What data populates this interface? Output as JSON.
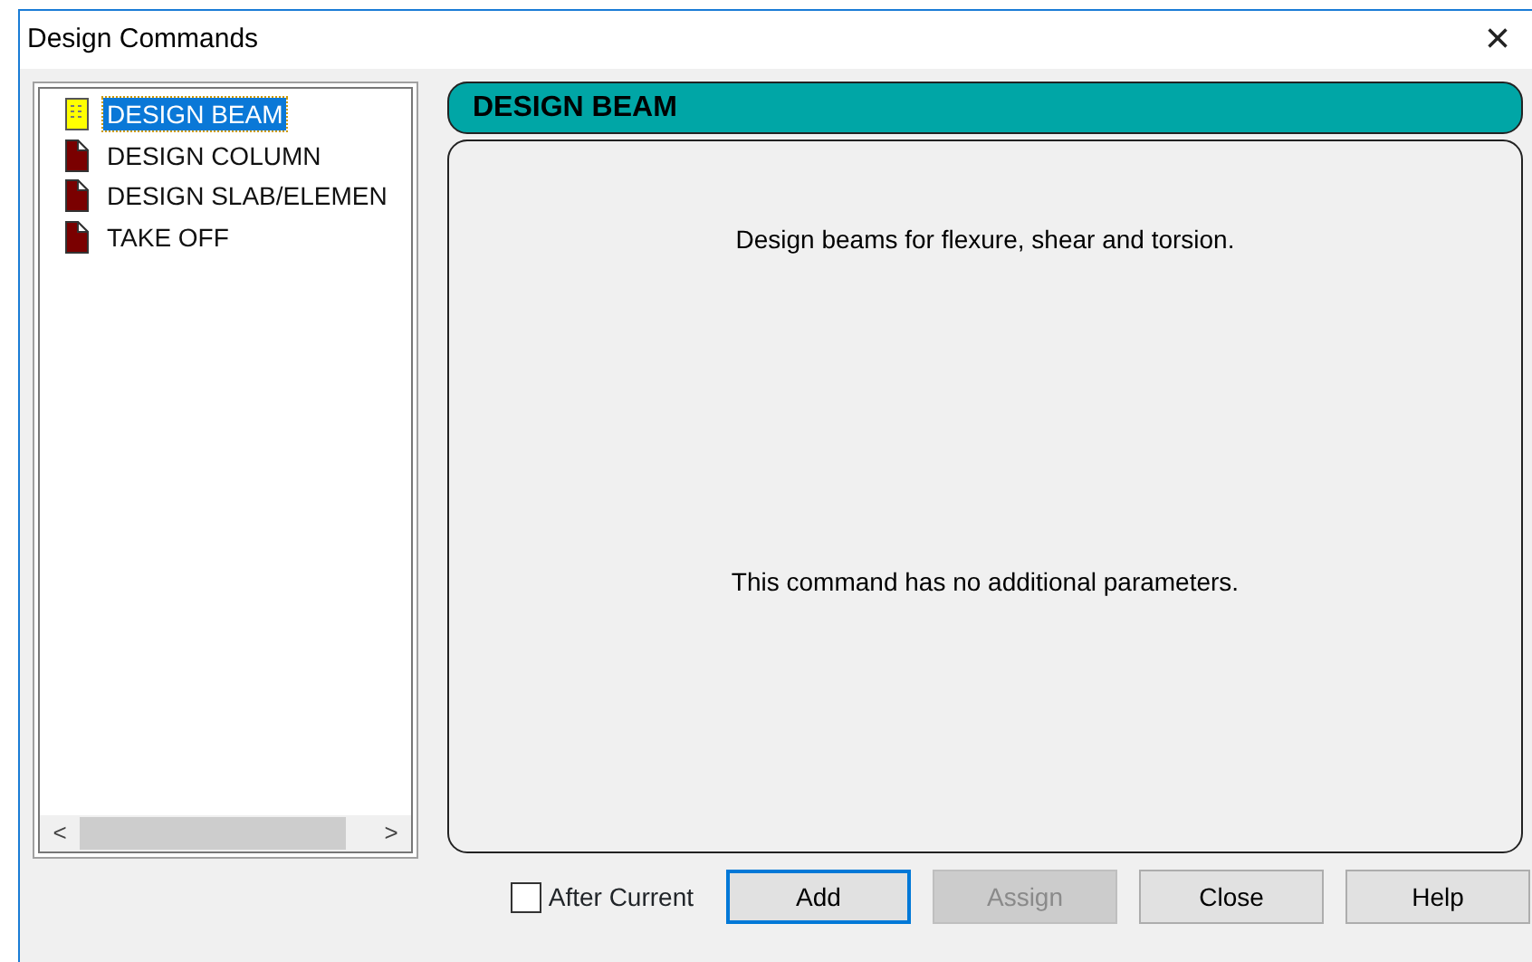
{
  "window": {
    "title": "Design Commands",
    "close": "×"
  },
  "commands": [
    {
      "label": "DESIGN BEAM",
      "selected": true
    },
    {
      "label": "DESIGN COLUMN",
      "selected": false
    },
    {
      "label": "DESIGN SLAB/ELEMEN",
      "selected": false
    },
    {
      "label": "TAKE OFF",
      "selected": false
    }
  ],
  "scrollbar": {
    "left": "<",
    "right": ">"
  },
  "header": "DESIGN BEAM",
  "description": "Design beams for flexure, shear and torsion.",
  "note": "This command has no additional parameters.",
  "after_current": {
    "label": "After Current",
    "checked": false
  },
  "buttons": [
    {
      "label": "Add",
      "focused": true,
      "disabled": false
    },
    {
      "label": "Assign",
      "focused": false,
      "disabled": true
    },
    {
      "label": "Close",
      "focused": false,
      "disabled": false
    },
    {
      "label": "Help",
      "focused": false,
      "disabled": false
    }
  ]
}
